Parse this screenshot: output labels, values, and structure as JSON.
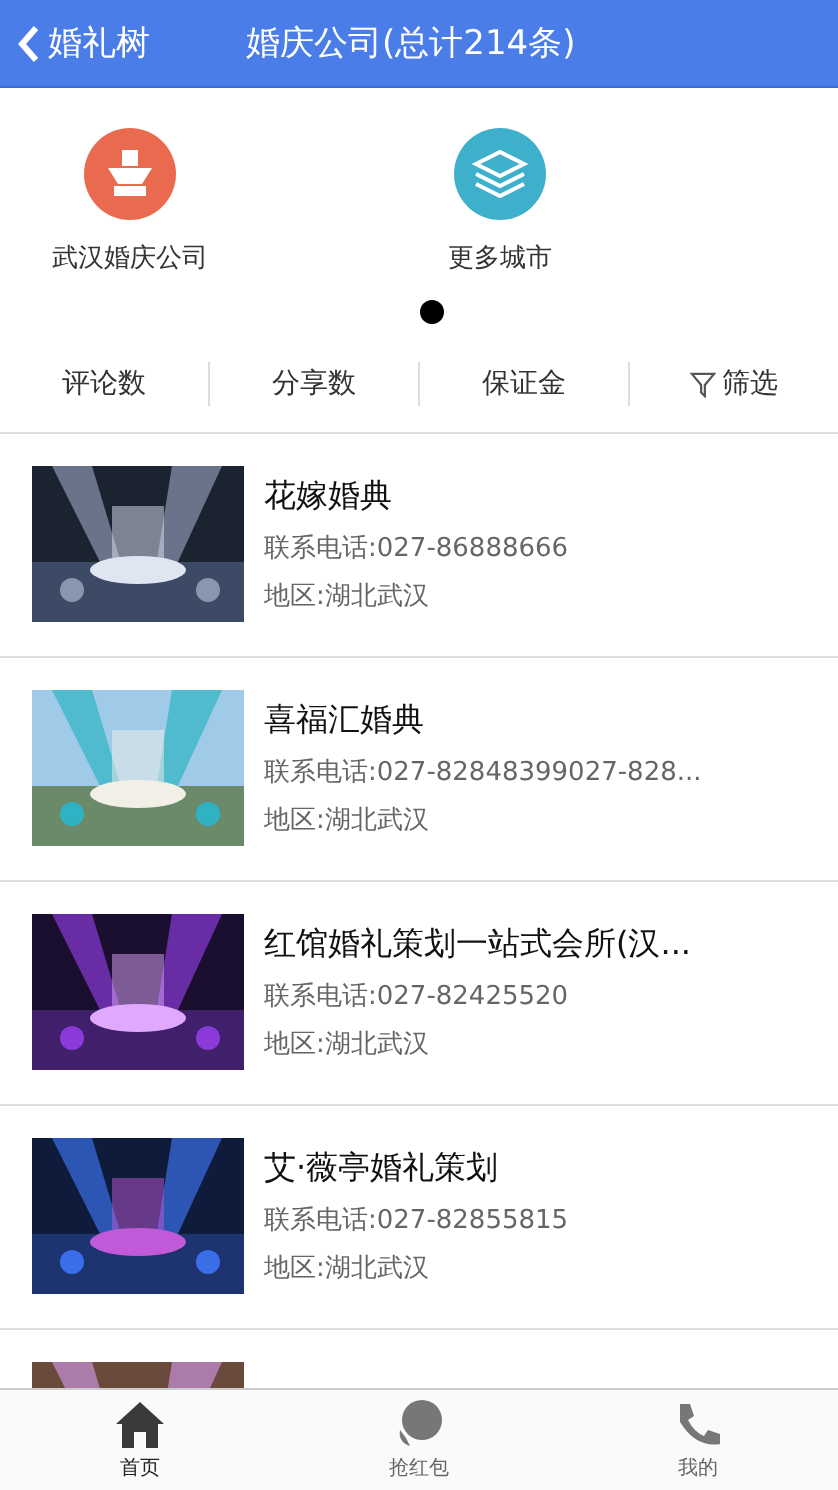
{
  "header": {
    "back_label": "婚礼树",
    "title": "婚庆公司(总计214条)"
  },
  "shortcuts": [
    {
      "label": "武汉婚庆公司",
      "kind": "cake"
    },
    {
      "label": "更多城市",
      "kind": "layers"
    }
  ],
  "pager": [
    {
      "selected": true
    }
  ],
  "sort_bar": [
    {
      "label": "评论数",
      "kind": "text"
    },
    {
      "label": "分享数",
      "kind": "text"
    },
    {
      "label": "保证金",
      "kind": "text"
    },
    {
      "label": "筛选",
      "kind": "filter"
    }
  ],
  "listings": [
    {
      "name": "花嫁婚典",
      "phone": "联系电话:027-86888666",
      "region": "地区:湖北武汉",
      "kind": "picture"
    },
    {
      "name": "喜福汇婚典",
      "phone": "联系电话:027-82848399027-828...",
      "region": "地区:湖北武汉",
      "kind": "picture"
    },
    {
      "name": "红馆婚礼策划一站式会所(汉...",
      "phone": "联系电话:027-82425520",
      "region": "地区:湖北武汉",
      "kind": "picture"
    },
    {
      "name": "艾·薇亭婚礼策划",
      "phone": "联系电话:027-82855815",
      "region": "地区:湖北武汉",
      "kind": "picture"
    },
    {
      "kind": "picture"
    }
  ],
  "tab_bar": [
    {
      "label": "首页",
      "kind": "home",
      "selected": true
    },
    {
      "label": "抢红包",
      "kind": "chat",
      "selected": false
    },
    {
      "label": "我的",
      "kind": "phone",
      "selected": false
    }
  ]
}
